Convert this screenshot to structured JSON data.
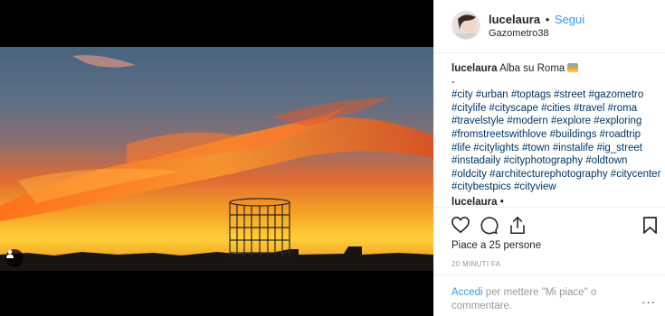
{
  "header": {
    "username": "lucelaura",
    "separator": "•",
    "follow_label": "Segui",
    "location": "Gazometro38"
  },
  "caption": {
    "username": "lucelaura",
    "text": "Alba su Roma",
    "dash": "-",
    "hashtags": "#city #urban #toptags #street #gazometro #citylife #cityscape #cities #travel #roma #travelstyle #modern #explore #exploring #fromstreetswithlove #buildings #roadtrip #life #citylights #town #instalife #ig_street #instadaily #cityphotography #oldtown #oldcity #architecturephotography #citycenter #citybestpics #cityview",
    "emoji_icon": "sunrise-icon"
  },
  "comment": {
    "username": "lucelaura •"
  },
  "actions": {
    "icons": [
      "heart-icon",
      "comment-icon",
      "share-icon",
      "bookmark-icon"
    ]
  },
  "likes": {
    "text": "Piace a 25 persone"
  },
  "time": {
    "text": "20 MINUTI FA"
  },
  "login": {
    "link": "Accedi",
    "rest": " per mettere \"Mi piace\" o commentare.",
    "more": "···"
  },
  "colors": {
    "accent": "#3897f0",
    "hashtag": "#003569",
    "muted": "#999999",
    "border": "#efefef"
  }
}
